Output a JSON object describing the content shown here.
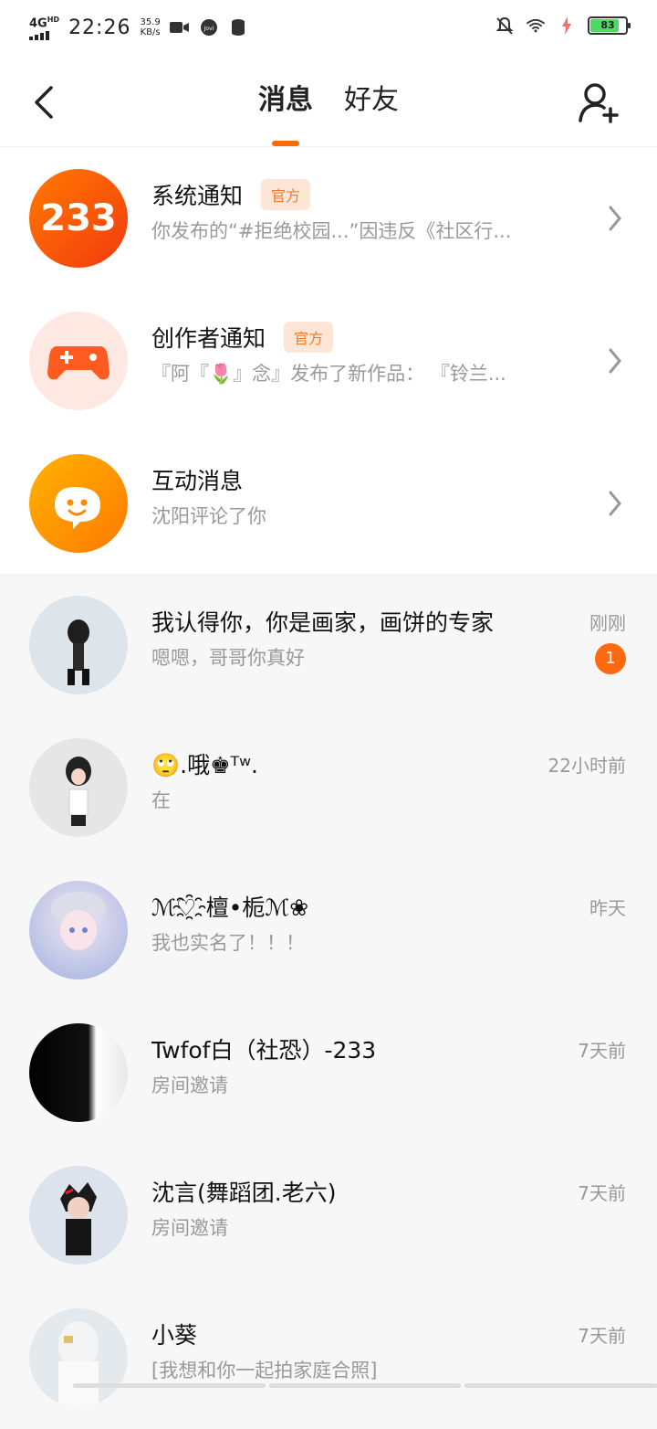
{
  "status_bar": {
    "network": "4G",
    "network_sup": "HD",
    "time": "22:26",
    "speed_value": "35.9",
    "speed_unit": "KB/s",
    "battery": "83"
  },
  "header": {
    "tabs": [
      {
        "label": "消息",
        "active": true
      },
      {
        "label": "好友",
        "active": false
      }
    ]
  },
  "system_items": [
    {
      "title": "系统通知",
      "badge": "官方",
      "subtitle": "你发布的“#拒绝校园...”因违反《社区行...",
      "avatar_label": "233"
    },
    {
      "title": "创作者通知",
      "badge": "官方",
      "subtitle": "『阿『🌷』念』发布了新作品：   『铃兰..."
    },
    {
      "title": "互动消息",
      "subtitle": "沈阳评论了你"
    }
  ],
  "chats": [
    {
      "name": "我认得你，你是画家，画饼的专家",
      "message": "嗯嗯，哥哥你真好",
      "time": "刚刚",
      "unread": "1"
    },
    {
      "name": "🙄.哦♚ᵀʷ.",
      "message": "在",
      "time": "22小时前"
    },
    {
      "name": "ℳ♡҈檀•栀ℳ❀",
      "message": "我也实名了！！！",
      "time": "昨天"
    },
    {
      "name": "Twfof白（社恐）-233",
      "message": "房间邀请",
      "time": "7天前"
    },
    {
      "name": "沈言(舞蹈团.老六)",
      "message": "房间邀请",
      "time": "7天前"
    },
    {
      "name": "小葵",
      "message": "[我想和你一起拍家庭合照]",
      "time": "7天前"
    }
  ],
  "colors": {
    "accent": "#ff6a00",
    "badge_bg": "#fde6d6",
    "badge_text": "#f07a2c"
  }
}
